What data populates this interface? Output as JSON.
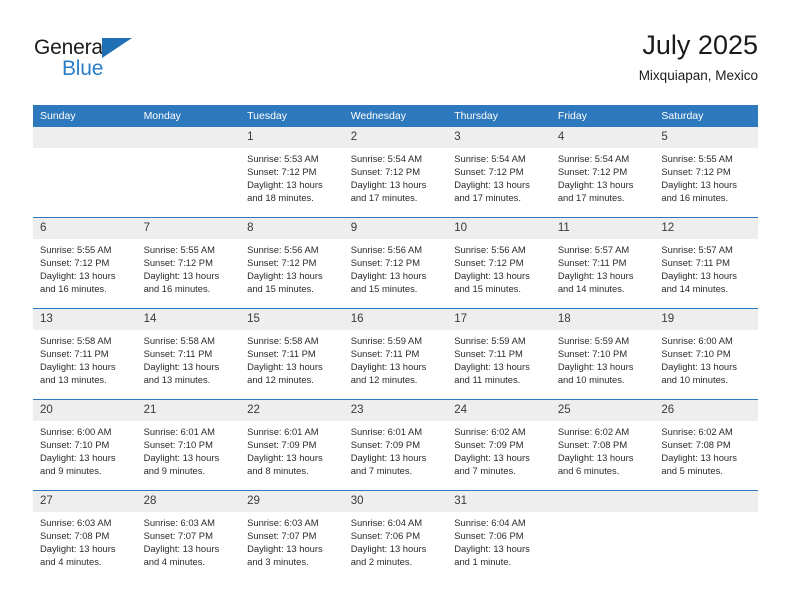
{
  "brand": {
    "name_top": "General",
    "name_bottom": "Blue",
    "accent_color": "#2a7fc9",
    "triangle_color": "#1f6fb5"
  },
  "header": {
    "title": "July 2025",
    "subtitle": "Mixquiapan, Mexico"
  },
  "colors": {
    "header_row_bg": "#2e79bd",
    "header_row_text": "#ffffff",
    "daynum_bg": "#eeeeee",
    "row_divider": "#2e79bd",
    "body_text": "#2b2b2b"
  },
  "calendar": {
    "weekday_headers": [
      "Sunday",
      "Monday",
      "Tuesday",
      "Wednesday",
      "Thursday",
      "Friday",
      "Saturday"
    ],
    "weeks": [
      [
        {
          "day": "",
          "lines": []
        },
        {
          "day": "",
          "lines": []
        },
        {
          "day": "1",
          "lines": [
            "Sunrise: 5:53 AM",
            "Sunset: 7:12 PM",
            "Daylight: 13 hours",
            "and 18 minutes."
          ]
        },
        {
          "day": "2",
          "lines": [
            "Sunrise: 5:54 AM",
            "Sunset: 7:12 PM",
            "Daylight: 13 hours",
            "and 17 minutes."
          ]
        },
        {
          "day": "3",
          "lines": [
            "Sunrise: 5:54 AM",
            "Sunset: 7:12 PM",
            "Daylight: 13 hours",
            "and 17 minutes."
          ]
        },
        {
          "day": "4",
          "lines": [
            "Sunrise: 5:54 AM",
            "Sunset: 7:12 PM",
            "Daylight: 13 hours",
            "and 17 minutes."
          ]
        },
        {
          "day": "5",
          "lines": [
            "Sunrise: 5:55 AM",
            "Sunset: 7:12 PM",
            "Daylight: 13 hours",
            "and 16 minutes."
          ]
        }
      ],
      [
        {
          "day": "6",
          "lines": [
            "Sunrise: 5:55 AM",
            "Sunset: 7:12 PM",
            "Daylight: 13 hours",
            "and 16 minutes."
          ]
        },
        {
          "day": "7",
          "lines": [
            "Sunrise: 5:55 AM",
            "Sunset: 7:12 PM",
            "Daylight: 13 hours",
            "and 16 minutes."
          ]
        },
        {
          "day": "8",
          "lines": [
            "Sunrise: 5:56 AM",
            "Sunset: 7:12 PM",
            "Daylight: 13 hours",
            "and 15 minutes."
          ]
        },
        {
          "day": "9",
          "lines": [
            "Sunrise: 5:56 AM",
            "Sunset: 7:12 PM",
            "Daylight: 13 hours",
            "and 15 minutes."
          ]
        },
        {
          "day": "10",
          "lines": [
            "Sunrise: 5:56 AM",
            "Sunset: 7:12 PM",
            "Daylight: 13 hours",
            "and 15 minutes."
          ]
        },
        {
          "day": "11",
          "lines": [
            "Sunrise: 5:57 AM",
            "Sunset: 7:11 PM",
            "Daylight: 13 hours",
            "and 14 minutes."
          ]
        },
        {
          "day": "12",
          "lines": [
            "Sunrise: 5:57 AM",
            "Sunset: 7:11 PM",
            "Daylight: 13 hours",
            "and 14 minutes."
          ]
        }
      ],
      [
        {
          "day": "13",
          "lines": [
            "Sunrise: 5:58 AM",
            "Sunset: 7:11 PM",
            "Daylight: 13 hours",
            "and 13 minutes."
          ]
        },
        {
          "day": "14",
          "lines": [
            "Sunrise: 5:58 AM",
            "Sunset: 7:11 PM",
            "Daylight: 13 hours",
            "and 13 minutes."
          ]
        },
        {
          "day": "15",
          "lines": [
            "Sunrise: 5:58 AM",
            "Sunset: 7:11 PM",
            "Daylight: 13 hours",
            "and 12 minutes."
          ]
        },
        {
          "day": "16",
          "lines": [
            "Sunrise: 5:59 AM",
            "Sunset: 7:11 PM",
            "Daylight: 13 hours",
            "and 12 minutes."
          ]
        },
        {
          "day": "17",
          "lines": [
            "Sunrise: 5:59 AM",
            "Sunset: 7:11 PM",
            "Daylight: 13 hours",
            "and 11 minutes."
          ]
        },
        {
          "day": "18",
          "lines": [
            "Sunrise: 5:59 AM",
            "Sunset: 7:10 PM",
            "Daylight: 13 hours",
            "and 10 minutes."
          ]
        },
        {
          "day": "19",
          "lines": [
            "Sunrise: 6:00 AM",
            "Sunset: 7:10 PM",
            "Daylight: 13 hours",
            "and 10 minutes."
          ]
        }
      ],
      [
        {
          "day": "20",
          "lines": [
            "Sunrise: 6:00 AM",
            "Sunset: 7:10 PM",
            "Daylight: 13 hours",
            "and 9 minutes."
          ]
        },
        {
          "day": "21",
          "lines": [
            "Sunrise: 6:01 AM",
            "Sunset: 7:10 PM",
            "Daylight: 13 hours",
            "and 9 minutes."
          ]
        },
        {
          "day": "22",
          "lines": [
            "Sunrise: 6:01 AM",
            "Sunset: 7:09 PM",
            "Daylight: 13 hours",
            "and 8 minutes."
          ]
        },
        {
          "day": "23",
          "lines": [
            "Sunrise: 6:01 AM",
            "Sunset: 7:09 PM",
            "Daylight: 13 hours",
            "and 7 minutes."
          ]
        },
        {
          "day": "24",
          "lines": [
            "Sunrise: 6:02 AM",
            "Sunset: 7:09 PM",
            "Daylight: 13 hours",
            "and 7 minutes."
          ]
        },
        {
          "day": "25",
          "lines": [
            "Sunrise: 6:02 AM",
            "Sunset: 7:08 PM",
            "Daylight: 13 hours",
            "and 6 minutes."
          ]
        },
        {
          "day": "26",
          "lines": [
            "Sunrise: 6:02 AM",
            "Sunset: 7:08 PM",
            "Daylight: 13 hours",
            "and 5 minutes."
          ]
        }
      ],
      [
        {
          "day": "27",
          "lines": [
            "Sunrise: 6:03 AM",
            "Sunset: 7:08 PM",
            "Daylight: 13 hours",
            "and 4 minutes."
          ]
        },
        {
          "day": "28",
          "lines": [
            "Sunrise: 6:03 AM",
            "Sunset: 7:07 PM",
            "Daylight: 13 hours",
            "and 4 minutes."
          ]
        },
        {
          "day": "29",
          "lines": [
            "Sunrise: 6:03 AM",
            "Sunset: 7:07 PM",
            "Daylight: 13 hours",
            "and 3 minutes."
          ]
        },
        {
          "day": "30",
          "lines": [
            "Sunrise: 6:04 AM",
            "Sunset: 7:06 PM",
            "Daylight: 13 hours",
            "and 2 minutes."
          ]
        },
        {
          "day": "31",
          "lines": [
            "Sunrise: 6:04 AM",
            "Sunset: 7:06 PM",
            "Daylight: 13 hours",
            "and 1 minute."
          ]
        },
        {
          "day": "",
          "lines": []
        },
        {
          "day": "",
          "lines": []
        }
      ]
    ]
  }
}
